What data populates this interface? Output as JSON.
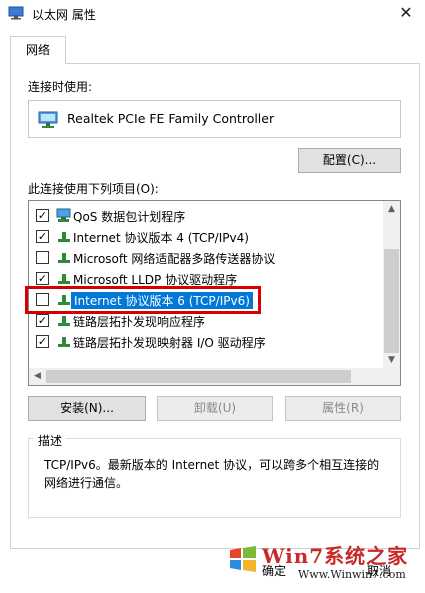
{
  "window": {
    "title": "以太网 属性",
    "close": "✕"
  },
  "tabs": [
    {
      "label": "网络"
    }
  ],
  "connect_using": {
    "label": "连接时使用:",
    "adapter": "Realtek PCIe FE Family Controller",
    "configure_label": "配置(C)..."
  },
  "items_section": {
    "label": "此连接使用下列项目(O):",
    "items": [
      {
        "checked": true,
        "text": "QoS 数据包计划程序"
      },
      {
        "checked": true,
        "text": "Internet 协议版本 4 (TCP/IPv4)"
      },
      {
        "checked": false,
        "text": "Microsoft 网络适配器多路传送器协议"
      },
      {
        "checked": true,
        "text": "Microsoft LLDP 协议驱动程序"
      },
      {
        "checked": false,
        "text": "Internet 协议版本 6 (TCP/IPv6)",
        "selected": true
      },
      {
        "checked": true,
        "text": "链路层拓扑发现响应程序"
      },
      {
        "checked": true,
        "text": "链路层拓扑发现映射器 I/O 驱动程序"
      }
    ]
  },
  "buttons": {
    "install": "安装(N)...",
    "uninstall": "卸载(U)",
    "properties": "属性(R)"
  },
  "description": {
    "title": "描述",
    "text": "TCP/IPv6。最新版本的 Internet 协议，可以跨多个相互连接的网络进行通信。"
  },
  "footer": {
    "ok_partial": "确定",
    "cancel_partial": "取消"
  },
  "watermark": {
    "title": "Win7系统之家",
    "url": "Www.Winwin7.com"
  },
  "colors": {
    "accent": "#0078d7",
    "highlight": "#d40000",
    "watermark": "#c62a2a"
  }
}
